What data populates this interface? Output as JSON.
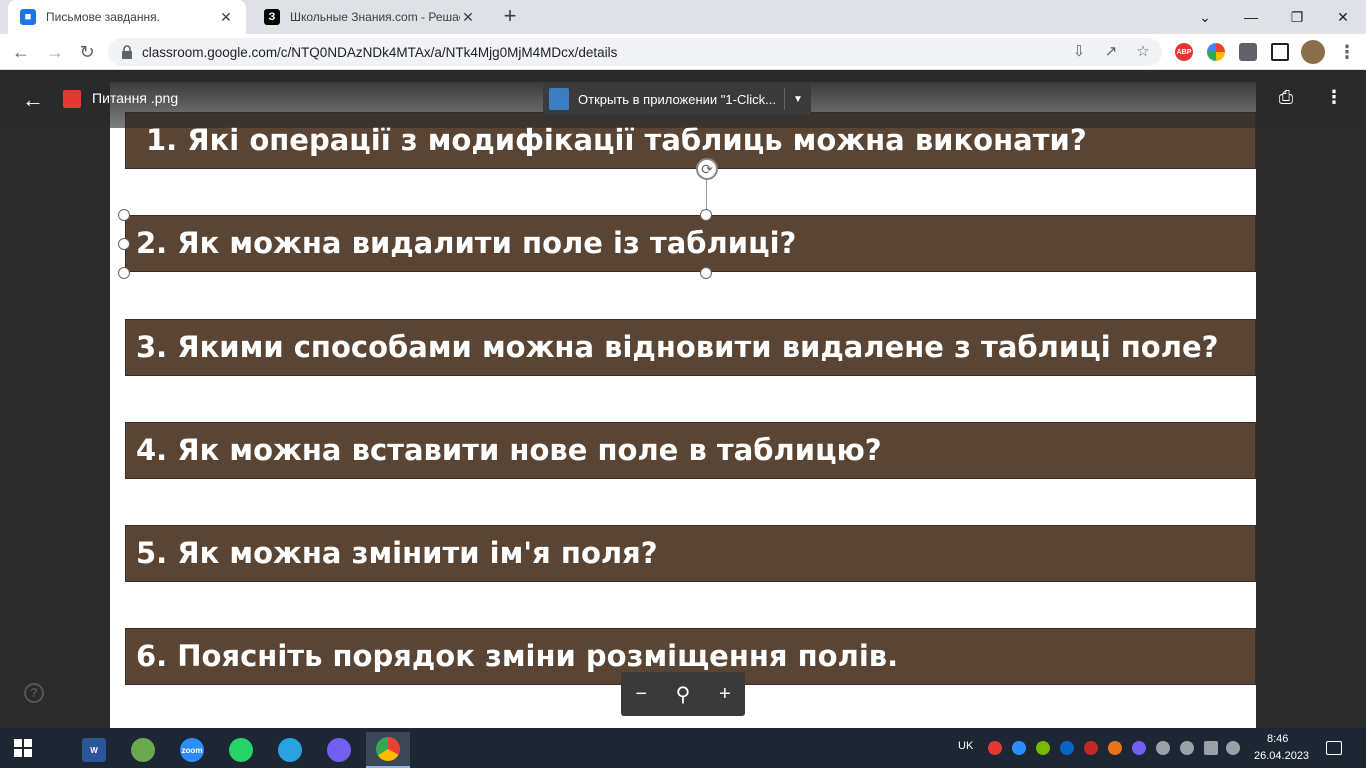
{
  "browser": {
    "tabs": [
      {
        "title": "Письмове завдання.",
        "favicon": "classroom-icon",
        "favicon_color": "#1e73e8",
        "active": true
      },
      {
        "title": "Школьные Знания.com - Решае",
        "favicon": "znanija-icon",
        "favicon_color": "#000000",
        "active": false
      }
    ],
    "new_tab": "+",
    "url": "classroom.google.com/c/NTQ0NDAzNDk4MTAx/a/NTk4Mjg0MjM4MDcx/details",
    "extensions": [
      {
        "name": "abp-icon",
        "label": "ABP",
        "color": "#e53935"
      },
      {
        "name": "google-lens-icon",
        "label": "",
        "color": "#fbbc04"
      },
      {
        "name": "puzzle-extensions-icon",
        "label": "",
        "color": "#5f6368"
      }
    ]
  },
  "viewer": {
    "file_name": "Питання .png",
    "open_with_label": "Открыть в приложении \"1-Click...",
    "questions": [
      "1. Які операції з модифікації таблиць можна виконати?",
      "2. Як можна видалити поле із таблиці?",
      "3. Якими способами можна відновити видалене з таблиці поле?",
      "4. Як можна вставити нове поле в таблицю?",
      "5. Як можна змінити ім'я поля?",
      "6. Поясніть порядок зміни розміщення полів."
    ],
    "zoom": {
      "minus": "−",
      "plus": "+"
    },
    "help": "?"
  },
  "taskbar": {
    "apps": [
      {
        "name": "word-app",
        "label": "W",
        "color": "#2b579a"
      },
      {
        "name": "paint-app",
        "label": "",
        "color": "#6aa84f"
      },
      {
        "name": "zoom-app",
        "label": "zoom",
        "color": "#2d8cff"
      },
      {
        "name": "whatsapp-app",
        "label": "",
        "color": "#25d366"
      },
      {
        "name": "telegram-app",
        "label": "",
        "color": "#2aa3e0"
      },
      {
        "name": "viber-app",
        "label": "",
        "color": "#7360f2"
      },
      {
        "name": "chrome-app",
        "label": "",
        "color": "#ea4335"
      }
    ],
    "language": "UK",
    "time": "8:46",
    "date": "26.04.2023"
  }
}
